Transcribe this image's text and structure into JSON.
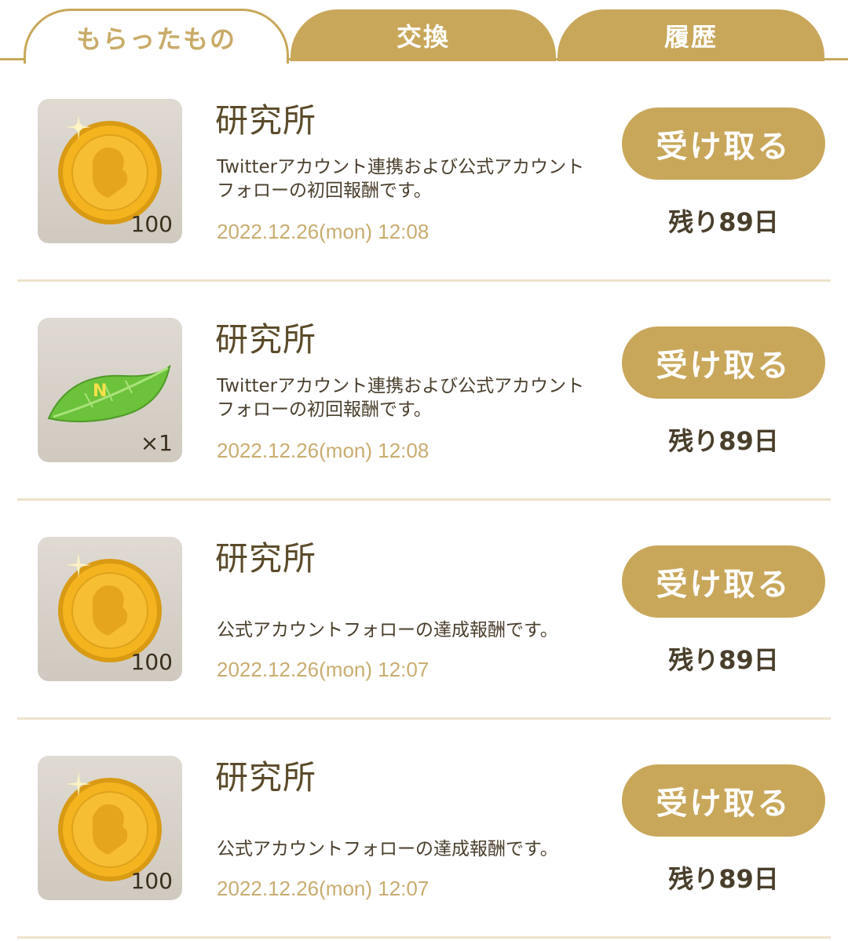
{
  "tabs": [
    {
      "label": "もらったもの",
      "active": true
    },
    {
      "label": "交換",
      "active": false
    },
    {
      "label": "履歴",
      "active": false
    }
  ],
  "colors": {
    "accent": "#c8a75b",
    "date": "#c9ac70",
    "divider": "#ede2cc"
  },
  "items": [
    {
      "icon": "gold-coin-icon",
      "quantity": "100",
      "title": "研究所",
      "description": "Twitterアカウント連携および公式アカウントフォローの初回報酬です。",
      "date": "2022.12.26(mon) 12:08",
      "button": "受け取る",
      "remaining": "残り89日"
    },
    {
      "icon": "green-leaf-icon",
      "quantity": "×1",
      "title": "研究所",
      "description": "Twitterアカウント連携および公式アカウントフォローの初回報酬です。",
      "date": "2022.12.26(mon) 12:08",
      "button": "受け取る",
      "remaining": "残り89日"
    },
    {
      "icon": "gold-coin-icon",
      "quantity": "100",
      "title": "研究所",
      "description": "公式アカウントフォローの達成報酬です。",
      "date": "2022.12.26(mon) 12:07",
      "button": "受け取る",
      "remaining": "残り89日"
    },
    {
      "icon": "gold-coin-icon",
      "quantity": "100",
      "title": "研究所",
      "description": "公式アカウントフォローの達成報酬です。",
      "date": "2022.12.26(mon) 12:07",
      "button": "受け取る",
      "remaining": "残り89日"
    }
  ]
}
